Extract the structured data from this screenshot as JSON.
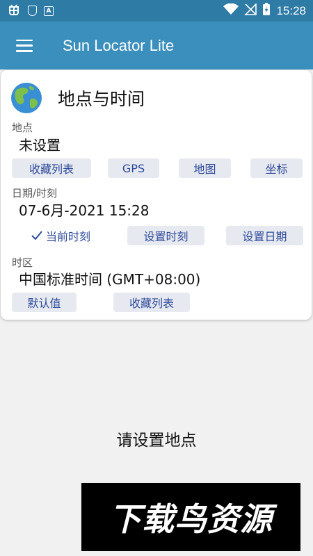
{
  "status_bar": {
    "time": "15:28",
    "app_icon_letter": "A"
  },
  "app_bar": {
    "title": "Sun Locator Lite"
  },
  "card": {
    "title": "地点与时间",
    "location": {
      "label": "地点",
      "value": "未设置",
      "buttons": [
        "收藏列表",
        "GPS",
        "地图",
        "坐标"
      ]
    },
    "datetime": {
      "label": "日期/时刻",
      "value": "07-6月-2021 15:28",
      "current_time_label": "当前时刻",
      "set_time_label": "设置时刻",
      "set_date_label": "设置日期"
    },
    "timezone": {
      "label": "时区",
      "value": "中国标准时间 (GMT+08:00)",
      "buttons": [
        "默认值",
        "收藏列表"
      ]
    }
  },
  "main": {
    "empty_message": "请设置地点"
  },
  "watermark": {
    "text": "下载鸟资源"
  },
  "colors": {
    "status_bar": "#2e7ba6",
    "app_bar": "#3b8fbc",
    "button_text": "#2d4a9a",
    "button_bg": "#e7e9f0"
  }
}
